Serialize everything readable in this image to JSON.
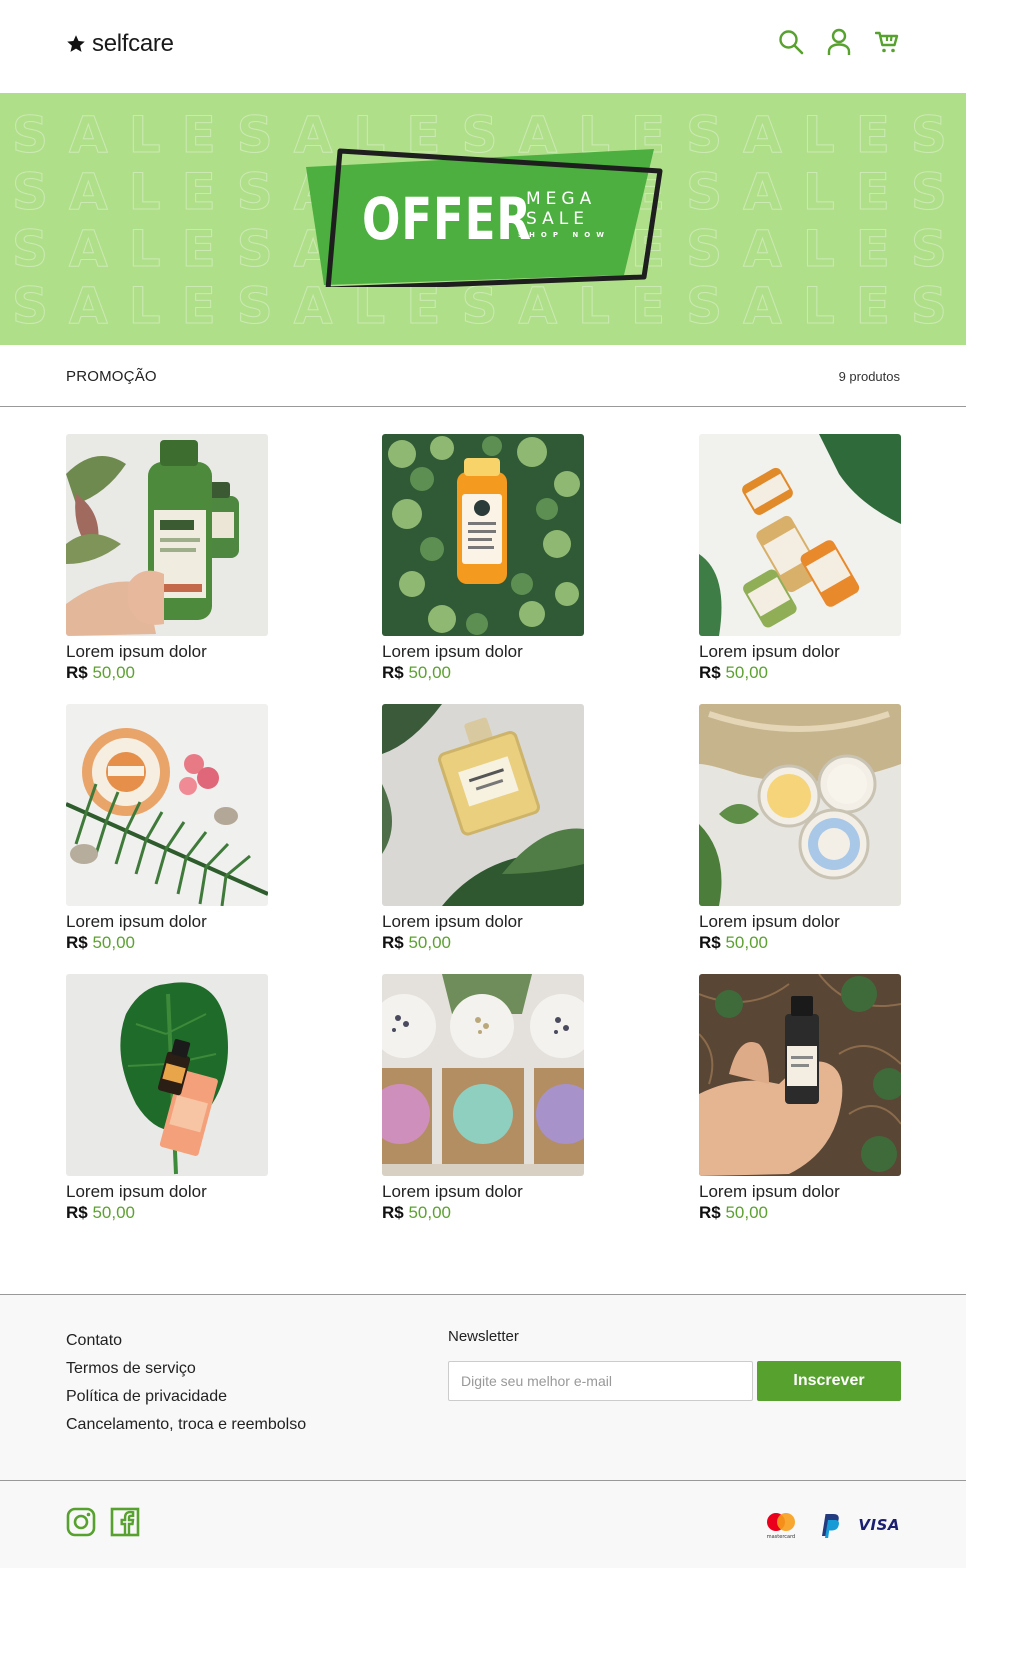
{
  "brand": {
    "name": "selfcare"
  },
  "header": {
    "icons": [
      "search-icon",
      "user-icon",
      "cart-icon"
    ]
  },
  "banner": {
    "background_word": "SALE",
    "offer_word": "OFFER",
    "mega_line1": "MEGA",
    "mega_line2": "SALE",
    "shop_line": "SHOP NOW"
  },
  "section": {
    "title": "PROMOÇÃO",
    "count": "9 produtos"
  },
  "products": [
    {
      "name": "Lorem ipsum dolor",
      "currency": "R$",
      "price": "50,00"
    },
    {
      "name": "Lorem ipsum dolor",
      "currency": "R$",
      "price": "50,00"
    },
    {
      "name": "Lorem ipsum dolor",
      "currency": "R$",
      "price": "50,00"
    },
    {
      "name": "Lorem ipsum dolor",
      "currency": "R$",
      "price": "50,00"
    },
    {
      "name": "Lorem ipsum dolor",
      "currency": "R$",
      "price": "50,00"
    },
    {
      "name": "Lorem ipsum dolor",
      "currency": "R$",
      "price": "50,00"
    },
    {
      "name": "Lorem ipsum dolor",
      "currency": "R$",
      "price": "50,00"
    },
    {
      "name": "Lorem ipsum dolor",
      "currency": "R$",
      "price": "50,00"
    },
    {
      "name": "Lorem ipsum dolor",
      "currency": "R$",
      "price": "50,00"
    }
  ],
  "footer": {
    "links": [
      "Contato",
      "Termos de serviço",
      "Política de privacidade",
      "Cancelamento, troca e reembolso"
    ],
    "newsletter": {
      "title": "Newsletter",
      "placeholder": "Digite seu melhor e-mail",
      "value": "",
      "button": "Inscrever"
    }
  },
  "bottom": {
    "social": [
      "instagram-icon",
      "facebook-icon"
    ],
    "payments": {
      "mastercard": "mastercard",
      "paypal": "paypal-icon",
      "visa": "VISA"
    }
  },
  "colors": {
    "accent": "#57a12e",
    "price": "#5da132",
    "banner": "#b0df8a",
    "offer_green": "#4caf3f"
  }
}
